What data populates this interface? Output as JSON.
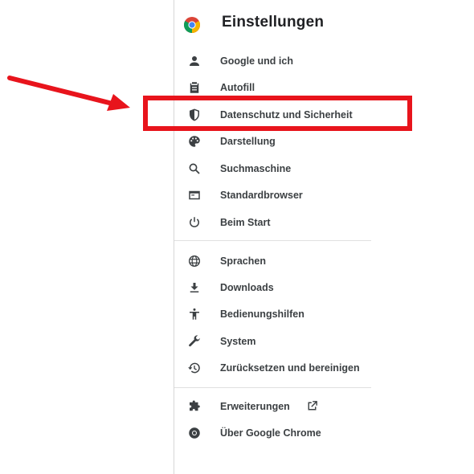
{
  "app": {
    "title": "Einstellungen"
  },
  "nav": {
    "group1": [
      {
        "label": "Google und ich",
        "icon": "person-icon"
      },
      {
        "label": "Autofill",
        "icon": "clipboard-icon"
      },
      {
        "label": "Datenschutz und Sicherheit",
        "icon": "shield-icon"
      },
      {
        "label": "Darstellung",
        "icon": "palette-icon"
      },
      {
        "label": "Suchmaschine",
        "icon": "search-icon"
      },
      {
        "label": "Standardbrowser",
        "icon": "browser-icon"
      },
      {
        "label": "Beim Start",
        "icon": "power-icon"
      }
    ],
    "group2": [
      {
        "label": "Sprachen",
        "icon": "globe-icon"
      },
      {
        "label": "Downloads",
        "icon": "download-icon"
      },
      {
        "label": "Bedienungshilfen",
        "icon": "accessibility-icon"
      },
      {
        "label": "System",
        "icon": "wrench-icon"
      },
      {
        "label": "Zurücksetzen und bereinigen",
        "icon": "history-icon"
      }
    ],
    "group3": [
      {
        "label": "Erweiterungen",
        "icon": "puzzle-icon"
      },
      {
        "label": "Über Google Chrome",
        "icon": "chrome-icon"
      }
    ]
  },
  "annotation": {
    "highlight_color": "#e8141c",
    "highlighted_item": "Datenschutz und Sicherheit"
  }
}
